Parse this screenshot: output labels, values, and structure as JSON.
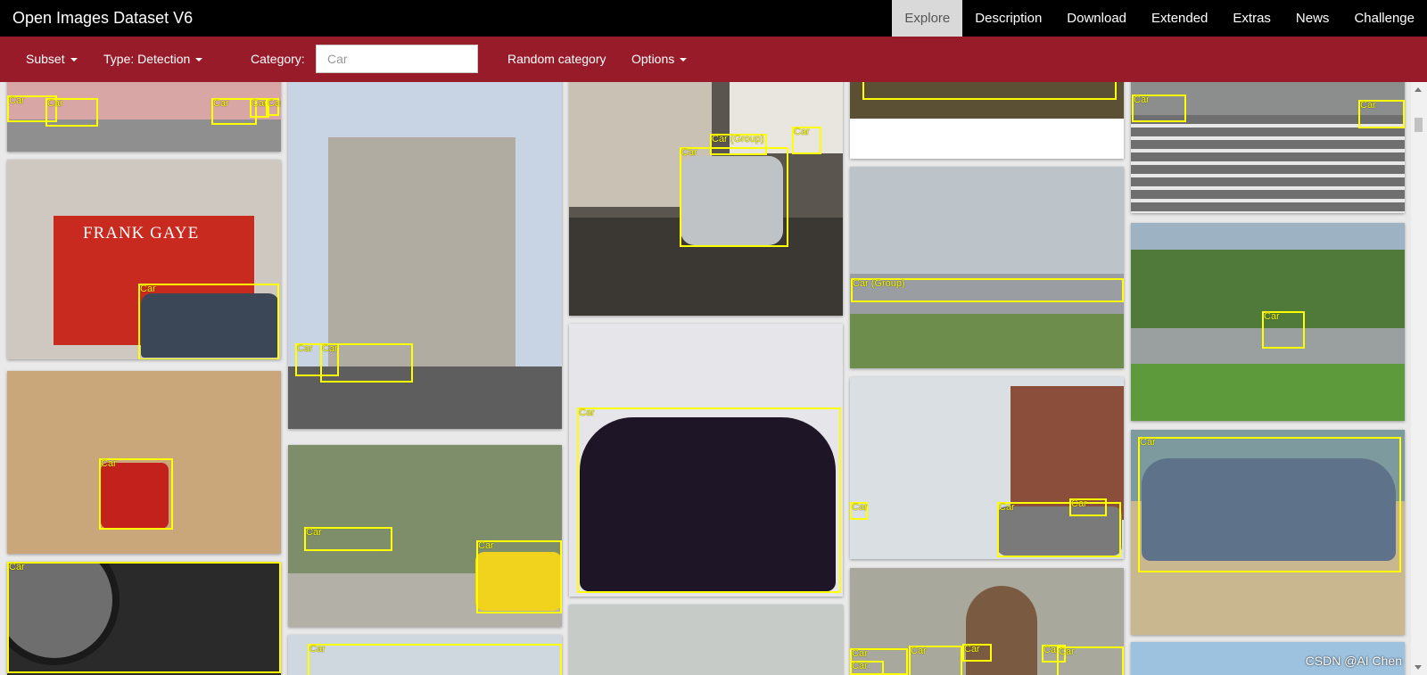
{
  "header": {
    "title": "Open Images Dataset V6",
    "nav": [
      "Explore",
      "Description",
      "Download",
      "Extended",
      "Extras",
      "News",
      "Challenge"
    ],
    "active_nav": "Explore"
  },
  "toolbar": {
    "subset_label": "Subset",
    "type_label": "Type: Detection",
    "category_label": "Category:",
    "category_placeholder": "Car",
    "random_label": "Random category",
    "options_label": "Options"
  },
  "images": {
    "t1": [
      "Car",
      "Car",
      "Car",
      "Car",
      "Car"
    ],
    "t2": [
      "Car"
    ],
    "t3": [
      "Car"
    ],
    "t4": [
      "Car"
    ],
    "t5": [
      "Car",
      "Car"
    ],
    "t6": [
      "Car",
      "Car"
    ],
    "t7": [
      "Car"
    ],
    "t8": [
      "Car (Group)",
      "Car",
      "Car"
    ],
    "t9": [
      "Car"
    ],
    "t11": [
      "Car (Group)"
    ],
    "t12": [
      "Car",
      "Car",
      "Car"
    ],
    "t13": [
      "Car",
      "Car",
      "Car",
      "Car",
      "Car",
      "Car"
    ],
    "t14": [
      "Car",
      "Car"
    ],
    "t15": [
      "Car"
    ],
    "t16": [
      "Car"
    ]
  },
  "shop_sign": "FRANK GAYE",
  "watermark": "CSDN @AI Chen",
  "colors": {
    "navbar": "#000000",
    "toolbar": "#981b2a",
    "box": "#ffff00",
    "active_tab": "#d9d9d9"
  }
}
